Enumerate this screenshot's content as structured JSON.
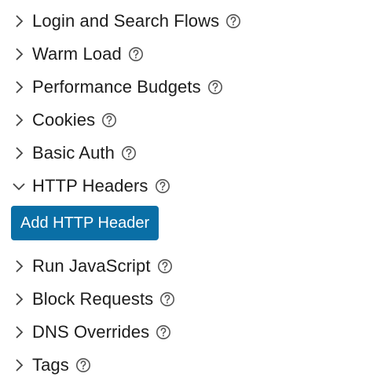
{
  "sections": [
    {
      "label": "Login and Search Flows",
      "expanded": false,
      "help_icon": "question-circle-icon"
    },
    {
      "label": "Warm Load",
      "expanded": false,
      "help_icon": "question-circle-icon"
    },
    {
      "label": "Performance Budgets",
      "expanded": false,
      "help_icon": "question-circle-icon"
    },
    {
      "label": "Cookies",
      "expanded": false,
      "help_icon": "question-circle-icon"
    },
    {
      "label": "Basic Auth",
      "expanded": false,
      "help_icon": "question-circle-icon"
    },
    {
      "label": "HTTP Headers",
      "expanded": true,
      "help_icon": "question-circle-icon"
    },
    {
      "label": "Run JavaScript",
      "expanded": false,
      "help_icon": "question-circle-icon"
    },
    {
      "label": "Block Requests",
      "expanded": false,
      "help_icon": "question-circle-icon"
    },
    {
      "label": "DNS Overrides",
      "expanded": false,
      "help_icon": "question-circle-icon"
    },
    {
      "label": "Tags",
      "expanded": false,
      "help_icon": "question-circle-icon"
    }
  ],
  "http_headers": {
    "add_button_label": "Add HTTP Header"
  },
  "colors": {
    "button_bg": "#0a6fa6",
    "button_text": "#ffffff",
    "text": "#1c1c1c",
    "icon": "#555555"
  }
}
